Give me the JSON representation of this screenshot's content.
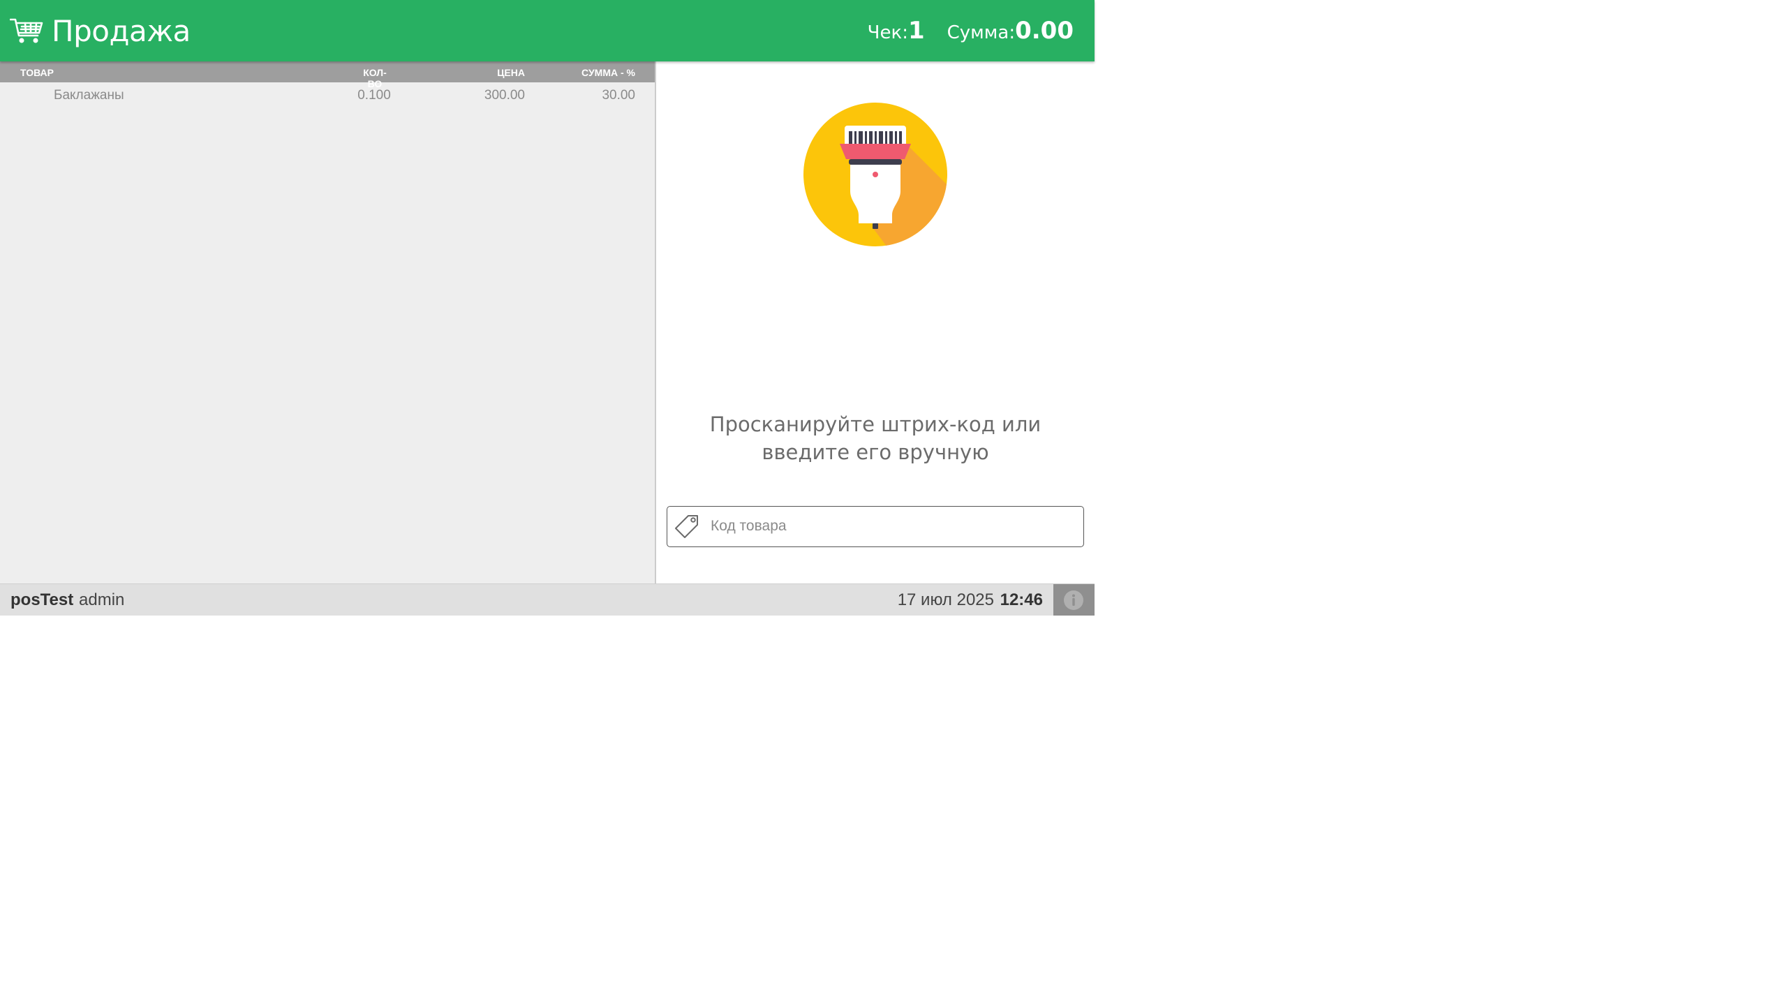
{
  "header": {
    "title": "Продажа",
    "receipt_label": "Чек:",
    "receipt_value": "1",
    "sum_label": "Сумма:",
    "sum_value": "0.00",
    "icon": "shopping-cart-icon"
  },
  "colors": {
    "header_bg": "#28b062",
    "table_header_bg": "#9e9e9e",
    "left_panel_bg": "#eeeeee",
    "scanner_circle": "#fcc50a",
    "scanner_band": "#ef5a6f"
  },
  "table": {
    "columns": [
      "ТОВАР",
      "КОЛ-ВО",
      "ЦЕНА",
      "СУММА - %"
    ],
    "rows": [
      {
        "name": "Баклажаны",
        "qty": "0.100",
        "price": "300.00",
        "sum": "30.00",
        "struck_through": true
      }
    ]
  },
  "scanner": {
    "icon": "barcode-scanner-icon",
    "prompt": "Просканируйте штрих-код или введите его вручную"
  },
  "code_input": {
    "placeholder": "Код товара",
    "value": "",
    "icon": "price-tag-icon"
  },
  "footer": {
    "store": "posTest",
    "user": "admin",
    "date": "17 июл 2025",
    "time": "12:46",
    "info_icon": "info-icon"
  }
}
